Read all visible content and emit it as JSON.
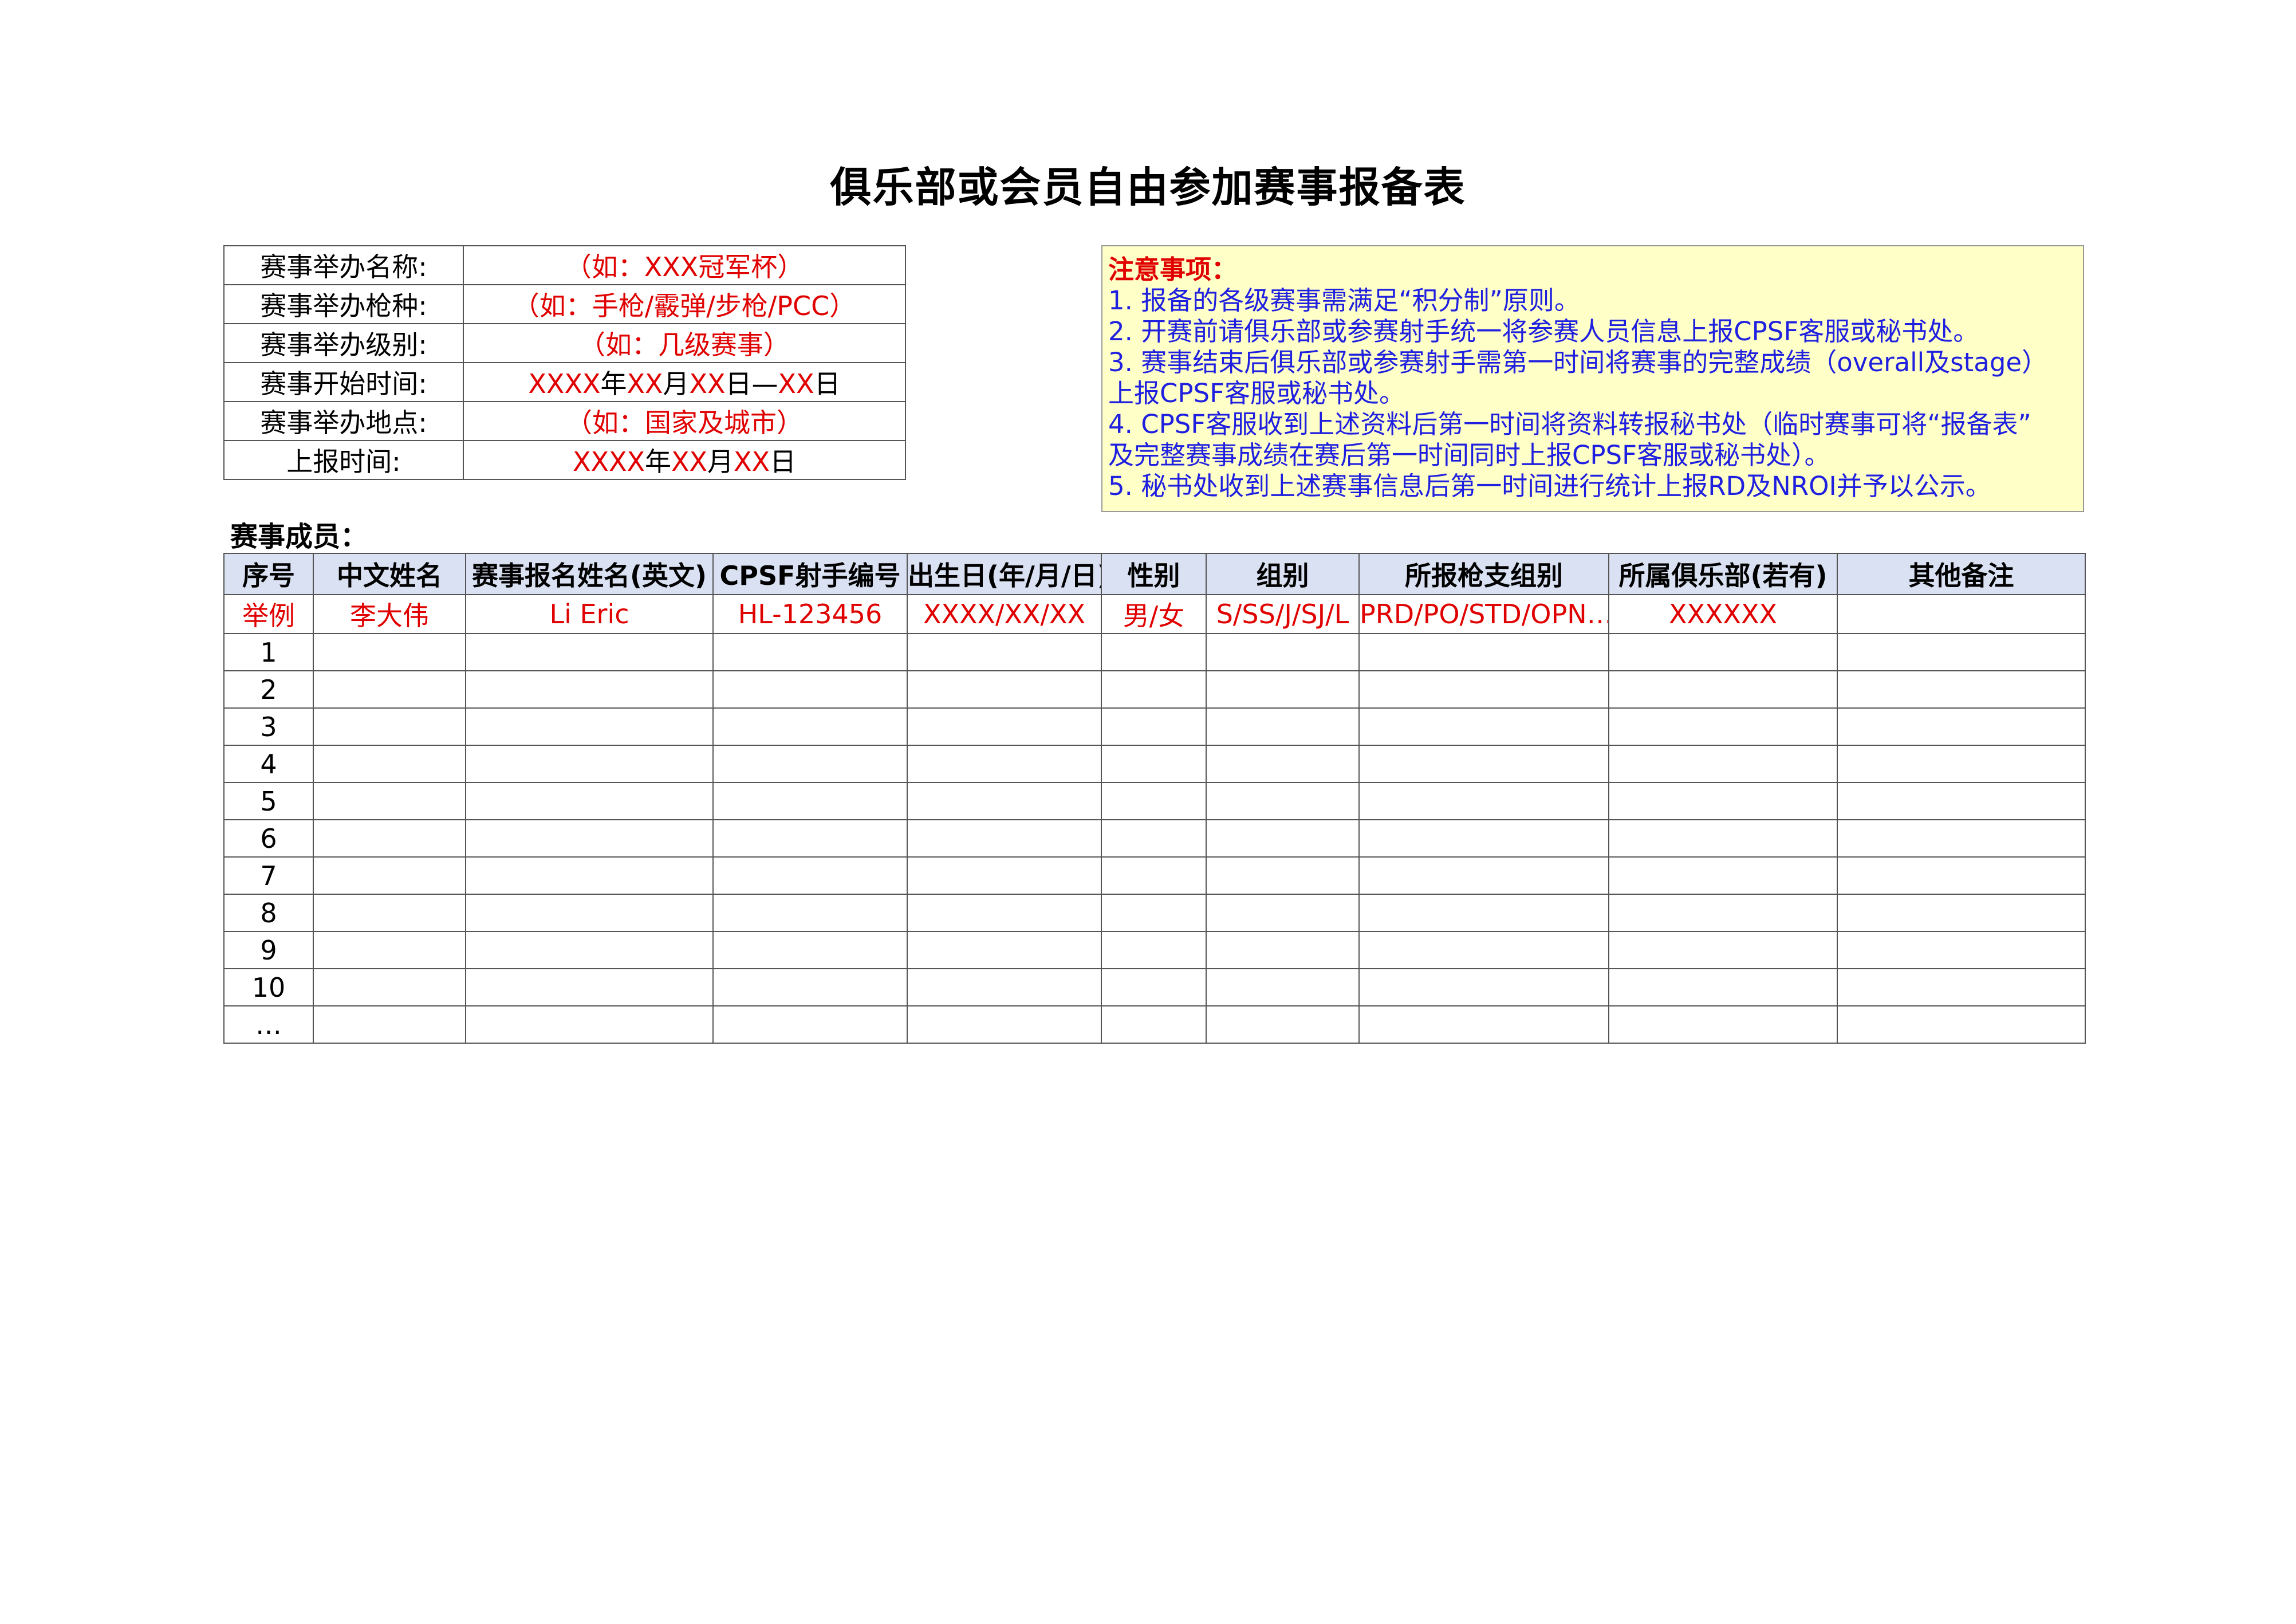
{
  "title": "俱乐部或会员自由参加赛事报备表",
  "info_rows": [
    {
      "label": "赛事举办名称:",
      "value_parts": [
        {
          "text": "（如：XXX冠军杯）",
          "red": true
        }
      ]
    },
    {
      "label": "赛事举办枪种:",
      "value_parts": [
        {
          "text": "（如：手枪/霰弹/步枪/PCC）",
          "red": true
        }
      ]
    },
    {
      "label": "赛事举办级别:",
      "value_parts": [
        {
          "text": "（如：几级赛事）",
          "red": true
        }
      ]
    },
    {
      "label": "赛事开始时间:",
      "value_parts": [
        {
          "text": "XXXX",
          "red": true
        },
        {
          "text": "年",
          "red": false
        },
        {
          "text": "XX",
          "red": true
        },
        {
          "text": "月",
          "red": false
        },
        {
          "text": "XX",
          "red": true
        },
        {
          "text": "日—",
          "red": false
        },
        {
          "text": "XX",
          "red": true
        },
        {
          "text": "日",
          "red": false
        }
      ]
    },
    {
      "label": "赛事举办地点:",
      "value_parts": [
        {
          "text": "（如：国家及城市）",
          "red": true
        }
      ]
    },
    {
      "label": "上报时间:",
      "value_parts": [
        {
          "text": "XXXX",
          "red": true
        },
        {
          "text": "年",
          "red": false
        },
        {
          "text": "XX",
          "red": true
        },
        {
          "text": "月",
          "red": false
        },
        {
          "text": "XX",
          "red": true
        },
        {
          "text": "日",
          "red": false
        }
      ]
    }
  ],
  "notes": {
    "heading": "注意事项：",
    "lines": [
      "1. 报备的各级赛事需满足“积分制”原则。",
      "2. 开赛前请俱乐部或参赛射手统一将参赛人员信息上报CPSF客服或秘书处。",
      "3. 赛事结束后俱乐部或参赛射手需第一时间将赛事的完整成绩（overall及stage）",
      "上报CPSF客服或秘书处。",
      "4. CPSF客服收到上述资料后第一时间将资料转报秘书处（临时赛事可将“报备表”",
      "及完整赛事成绩在赛后第一时间同时上报CPSF客服或秘书处）。",
      "5. 秘书处收到上述赛事信息后第一时间进行统计上报RD及NROI并予以公示。"
    ]
  },
  "members_label": "赛事成员：",
  "members_table": {
    "headers": [
      "序号",
      "中文姓名",
      "赛事报名姓名(英文)",
      "CPSF射手编号",
      "出生日(年/月/日)",
      "性别",
      "组别",
      "所报枪支组别",
      "所属俱乐部(若有)",
      "其他备注"
    ],
    "example_row": [
      "举例",
      "李大伟",
      "Li Eric",
      "HL-123456",
      "XXXX/XX/XX",
      "男/女",
      "S/SS/J/SJ/L",
      "PRD/PO/STD/OPN…",
      "XXXXXX",
      ""
    ],
    "row_numbers": [
      "1",
      "2",
      "3",
      "4",
      "5",
      "6",
      "7",
      "8",
      "9",
      "10",
      "…"
    ]
  },
  "colors": {
    "accent_red": "#e00000",
    "notes_text": "#1f1fe0",
    "notes_bg": "#ffffc8",
    "header_bg": "#d9e1f2"
  }
}
